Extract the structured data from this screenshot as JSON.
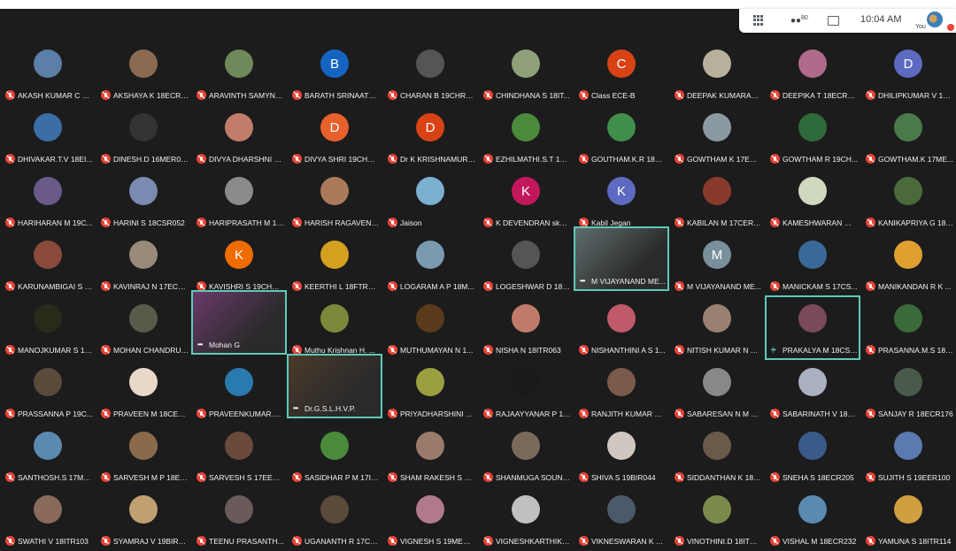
{
  "toolbar": {
    "people_count": "80",
    "time": "10:04 AM",
    "self_label": "You"
  },
  "participants": [
    {
      "name": "AKASH KUMAR C 19...",
      "col": "#5b7fa6",
      "init": ""
    },
    {
      "name": "AKSHAYA K 18ECR0...",
      "col": "#8c6a52",
      "init": ""
    },
    {
      "name": "ARAVINTH SAMYNA...",
      "col": "#6f8a5a",
      "init": ""
    },
    {
      "name": "BARATH SRINAATH ...",
      "col": "#1565c0",
      "init": "B"
    },
    {
      "name": "CHARAN B 19CHR010",
      "col": "#555555",
      "init": ""
    },
    {
      "name": "CHINDHANA S 18IT...",
      "col": "#8fa07a",
      "init": ""
    },
    {
      "name": "Class ECE-B",
      "col": "#d84315",
      "init": "C"
    },
    {
      "name": "DEEPAK KUMARAN ...",
      "col": "#b7b09a",
      "init": ""
    },
    {
      "name": "DEEPIKA T 18ECR033",
      "col": "#b06a8a",
      "init": ""
    },
    {
      "name": "DHILIPKUMAR V 19...",
      "col": "#5c6bc0",
      "init": "D"
    },
    {
      "name": "DHIVAKAR.T.V 18EI...",
      "col": "#3a6ea5",
      "init": ""
    },
    {
      "name": "DINESH.D 16MER049",
      "col": "#333333",
      "init": ""
    },
    {
      "name": "DIVYA DHARSHNI M...",
      "col": "#c27c6a",
      "init": ""
    },
    {
      "name": "DIVYA SHRI 19CHR0...",
      "col": "#e8602c",
      "init": "D"
    },
    {
      "name": "Dr K KRISHNAMURT...",
      "col": "#d84315",
      "init": "D"
    },
    {
      "name": "EZHILMATHI.S.T 17I...",
      "col": "#4a8a3a",
      "init": ""
    },
    {
      "name": "GOUTHAM.K.R 18M...",
      "col": "#3f8f4a",
      "init": ""
    },
    {
      "name": "GOWTHAM K 17ECR...",
      "col": "#8a9aa0",
      "init": ""
    },
    {
      "name": "GOWTHAM R 19CH...",
      "col": "#2f6a3a",
      "init": ""
    },
    {
      "name": "GOWTHAM.K 17ME...",
      "col": "#4a7a4a",
      "init": ""
    },
    {
      "name": "HARIHARAN M 19C...",
      "col": "#6a5a8a",
      "init": ""
    },
    {
      "name": "HARINI S 18CSR052",
      "col": "#7a8ab0",
      "init": ""
    },
    {
      "name": "HARIPRASATH M 18...",
      "col": "#8a8a8a",
      "init": ""
    },
    {
      "name": "HARISH RAGAVEND...",
      "col": "#aa7a5a",
      "init": ""
    },
    {
      "name": "Jaison",
      "col": "#7ab0d0",
      "init": ""
    },
    {
      "name": "K DEVENDRAN skde...",
      "col": "#c2185b",
      "init": "K"
    },
    {
      "name": "Kabil Jegan",
      "col": "#5c6bc0",
      "init": "K"
    },
    {
      "name": "KABILAN M 17CER0...",
      "col": "#8a3a2a",
      "init": ""
    },
    {
      "name": "KAMESHWARAN M ...",
      "col": "#d0d8c0",
      "init": ""
    },
    {
      "name": "KANIKAPRIYA G 18C...",
      "col": "#4a6a3a",
      "init": ""
    },
    {
      "name": "KARUNAMBIGAI S 1...",
      "col": "#8a4a3a",
      "init": ""
    },
    {
      "name": "KAVINRAJ N 17ECR...",
      "col": "#9a8a7a",
      "init": ""
    },
    {
      "name": "KAVISHRI S 19CHR0...",
      "col": "#ef6c00",
      "init": "K"
    },
    {
      "name": "KEERTHI L 18FTR025",
      "col": "#d4a020",
      "init": ""
    },
    {
      "name": "LOGARAM A P 18M...",
      "col": "#7a9ab0",
      "init": ""
    },
    {
      "name": "LOGESHWAR D 18E...",
      "col": "#555555",
      "init": ""
    },
    {
      "name": "M VIJAYANAND ME...",
      "col": "#5f6d6d",
      "init": ""
    },
    {
      "name": "M VIJAYANAND ME...",
      "col": "#78909c",
      "init": "M"
    },
    {
      "name": "MANICKAM S 17CS...",
      "col": "#3a6a9a",
      "init": ""
    },
    {
      "name": "MANIKANDAN R K ...",
      "col": "#e0a030",
      "init": ""
    },
    {
      "name": "MANOJKUMAR S 18...",
      "col": "#2a2a1a",
      "init": ""
    },
    {
      "name": "MOHAN CHANDRU ...",
      "col": "#5a5a4a",
      "init": ""
    },
    {
      "name": "Mohan G",
      "col": "#6a3a6a",
      "init": ""
    },
    {
      "name": "Muthu Krishnan H. ...",
      "col": "#7a8a3a",
      "init": ""
    },
    {
      "name": "MUTHUMAYAN N 1...",
      "col": "#5a3a1a",
      "init": ""
    },
    {
      "name": "NISHA N 18ITR063",
      "col": "#c07a6a",
      "init": ""
    },
    {
      "name": "NISHANTHINI A S 1...",
      "col": "#c05a6a",
      "init": ""
    },
    {
      "name": "NITISH KUMAR N R ...",
      "col": "#9a8070",
      "init": ""
    },
    {
      "name": "PRAKALYA M 18CSR...",
      "col": "#7a4a5a",
      "init": ""
    },
    {
      "name": "PRASANNA.M.S 18F...",
      "col": "#3a6a3a",
      "init": ""
    },
    {
      "name": "PRASSANNA P 19C...",
      "col": "#5a4a3a",
      "init": ""
    },
    {
      "name": "PRAVEEN M 18CEL2...",
      "col": "#e8d8c8",
      "init": ""
    },
    {
      "name": "PRAVEENKUMAR.M...",
      "col": "#2a7ab0",
      "init": ""
    },
    {
      "name": "Dr.G.S.L.H.V.P.",
      "col": "#4a3a2a",
      "init": ""
    },
    {
      "name": "PRIYADHARSHINI S ...",
      "col": "#9aa040",
      "init": ""
    },
    {
      "name": "RAJAAYYANAR P 19...",
      "col": "#1a1a1a",
      "init": ""
    },
    {
      "name": "RANJITH KUMAR P ...",
      "col": "#7a5a4a",
      "init": ""
    },
    {
      "name": "SABARESAN N M 17...",
      "col": "#888888",
      "init": ""
    },
    {
      "name": "SABARINATH V 18E...",
      "col": "#aab0c0",
      "init": ""
    },
    {
      "name": "SANJAY R 18ECR176",
      "col": "#4a5a4a",
      "init": ""
    },
    {
      "name": "SANTHOSH.S 17MT...",
      "col": "#5a8ab0",
      "init": ""
    },
    {
      "name": "SARVESH M P 18EIL...",
      "col": "#8a6a4a",
      "init": ""
    },
    {
      "name": "SARVESH S 17EER0...",
      "col": "#6a4a3a",
      "init": ""
    },
    {
      "name": "SASIDHAR P M 17IT...",
      "col": "#4a8a3a",
      "init": ""
    },
    {
      "name": "SHAM RAKESH S 18...",
      "col": "#9a7a6a",
      "init": ""
    },
    {
      "name": "SHANMUGA SOUND...",
      "col": "#7a6a5a",
      "init": ""
    },
    {
      "name": "SHIVA S 19BIR044",
      "col": "#d0c8c0",
      "init": ""
    },
    {
      "name": "SIDDANTHAN K 18E...",
      "col": "#6a5a4a",
      "init": ""
    },
    {
      "name": "SNEHA S 18ECR205",
      "col": "#3a5a8a",
      "init": ""
    },
    {
      "name": "SUJITH S 19EER100",
      "col": "#5a7ab0",
      "init": ""
    },
    {
      "name": "SWATHI V 18ITR103",
      "col": "#8a6a5a",
      "init": ""
    },
    {
      "name": "SYAMRAJ V 19BIR051",
      "col": "#c0a070",
      "init": ""
    },
    {
      "name": "TEENU PRASANTH...",
      "col": "#6a5a5a",
      "init": ""
    },
    {
      "name": "UGANANTH R 17CE...",
      "col": "#5a4a3a",
      "init": ""
    },
    {
      "name": "VIGNESH S 19MER2...",
      "col": "#b07a8a",
      "init": ""
    },
    {
      "name": "VIGNESHKARTHIK R...",
      "col": "#c0c0c0",
      "init": ""
    },
    {
      "name": "VIKNESWARAN K K ...",
      "col": "#4a5a6a",
      "init": ""
    },
    {
      "name": "VINOTHINI.D 18ITR1...",
      "col": "#7a8a4a",
      "init": ""
    },
    {
      "name": "VISHAL M 18ECR232",
      "col": "#5a8ab0",
      "init": ""
    },
    {
      "name": "YAMUNA S 18ITR114",
      "col": "#d0a040",
      "init": ""
    }
  ]
}
